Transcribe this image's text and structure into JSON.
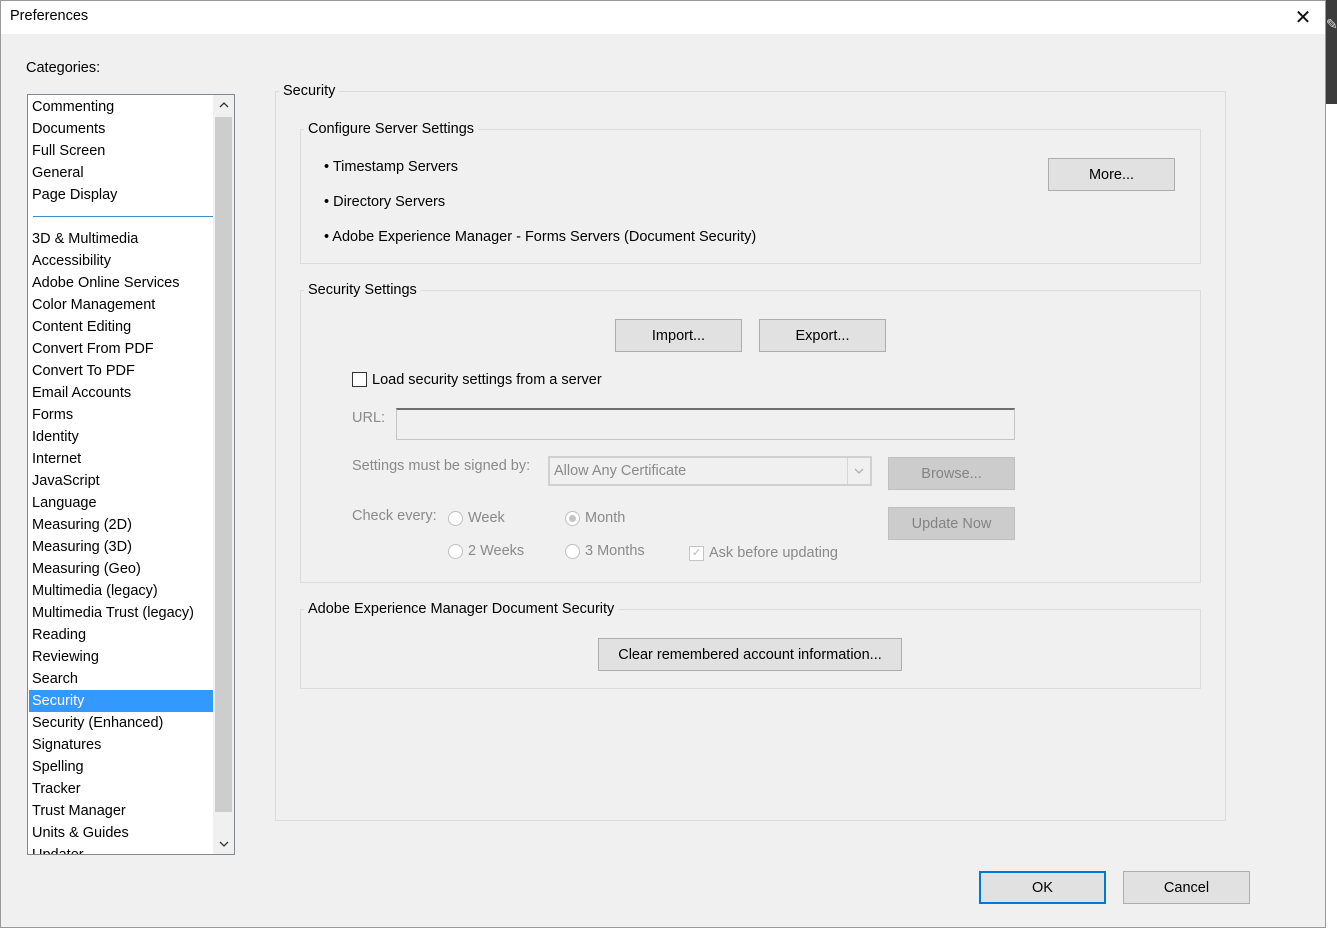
{
  "window": {
    "title": "Preferences"
  },
  "categories": {
    "label": "Categories:",
    "top_items": [
      "Commenting",
      "Documents",
      "Full Screen",
      "General",
      "Page Display"
    ],
    "items": [
      "3D & Multimedia",
      "Accessibility",
      "Adobe Online Services",
      "Color Management",
      "Content Editing",
      "Convert From PDF",
      "Convert To PDF",
      "Email Accounts",
      "Forms",
      "Identity",
      "Internet",
      "JavaScript",
      "Language",
      "Measuring (2D)",
      "Measuring (3D)",
      "Measuring (Geo)",
      "Multimedia (legacy)",
      "Multimedia Trust (legacy)",
      "Reading",
      "Reviewing",
      "Search",
      "Security",
      "Security (Enhanced)",
      "Signatures",
      "Spelling",
      "Tracker",
      "Trust Manager",
      "Units & Guides",
      "Updater"
    ],
    "selected": "Security"
  },
  "security": {
    "title": "Security",
    "server_settings": {
      "title": "Configure Server Settings",
      "bullets": [
        "• Timestamp Servers",
        "• Directory Servers",
        "• Adobe Experience Manager - Forms Servers (Document Security)"
      ],
      "more_button": "More..."
    },
    "security_settings": {
      "title": "Security Settings",
      "import_button": "Import...",
      "export_button": "Export...",
      "load_checkbox_label": "Load security settings from a server",
      "url_label": "URL:",
      "url_value": "",
      "signed_by_label": "Settings must be signed by:",
      "signed_by_value": "Allow Any Certificate",
      "browse_button": "Browse...",
      "check_every_label": "Check every:",
      "radio_week": "Week",
      "radio_month": "Month",
      "radio_2weeks": "2 Weeks",
      "radio_3months": "3 Months",
      "selected_interval": "Month",
      "ask_before_label": "Ask before updating",
      "ask_before_checked": true,
      "update_now_button": "Update Now"
    },
    "aem": {
      "title": "Adobe Experience Manager Document Security",
      "clear_button": "Clear remembered account information..."
    }
  },
  "footer": {
    "ok": "OK",
    "cancel": "Cancel"
  }
}
